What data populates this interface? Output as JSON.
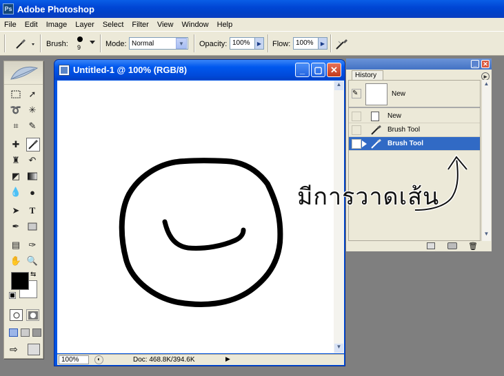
{
  "app": {
    "title": "Adobe Photoshop"
  },
  "menu": [
    "File",
    "Edit",
    "Image",
    "Layer",
    "Select",
    "Filter",
    "View",
    "Window",
    "Help"
  ],
  "options": {
    "brush_label": "Brush:",
    "brush_size": "9",
    "mode_label": "Mode:",
    "mode_value": "Normal",
    "opacity_label": "Opacity:",
    "opacity_value": "100%",
    "flow_label": "Flow:",
    "flow_value": "100%"
  },
  "document": {
    "title": "Untitled-1 @ 100% (RGB/8)",
    "zoom": "100%",
    "doc_info": "Doc: 468.8K/394.6K"
  },
  "history": {
    "tab": "History",
    "snapshot_label": "New",
    "items": [
      {
        "label": "New",
        "icon": "new-document-icon",
        "selected": false
      },
      {
        "label": "Brush Tool",
        "icon": "brush-icon",
        "selected": false
      },
      {
        "label": "Brush Tool",
        "icon": "brush-icon",
        "selected": true
      }
    ]
  },
  "annotation": {
    "text": "มีการวาดเส้น"
  },
  "colors": {
    "foreground": "#000000",
    "background": "#ffffff",
    "selection": "#316ac5",
    "title_blue": "#0054e3"
  }
}
